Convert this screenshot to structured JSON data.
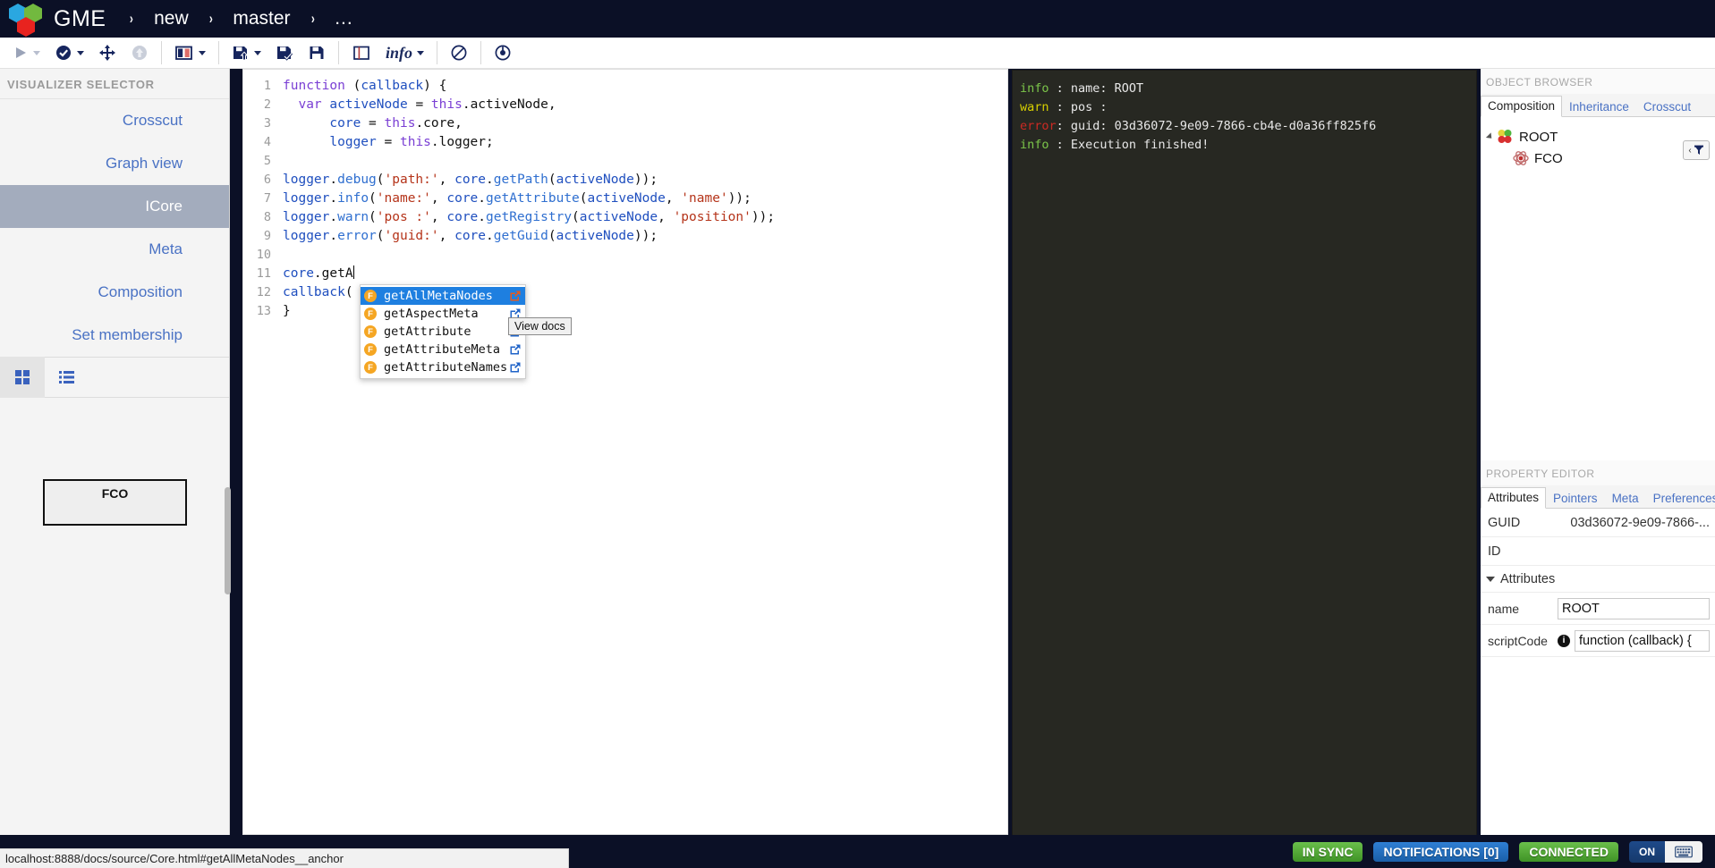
{
  "header": {
    "brand": "GME",
    "separator": "›",
    "breadcrumbs": [
      {
        "label": "new"
      },
      {
        "label": "master"
      },
      {
        "label": "..."
      }
    ]
  },
  "toolbar": {
    "items": [
      {
        "name": "execute-button",
        "icon": "play-icon",
        "caret": true
      },
      {
        "name": "check-button",
        "icon": "check-circle-icon",
        "caret": true
      },
      {
        "name": "move-button",
        "icon": "move-arrows-icon",
        "caret": false
      },
      {
        "name": "upload-button",
        "icon": "up-arrow-circle-icon",
        "caret": false
      },
      {
        "name": "split-view-button",
        "icon": "columns-icon",
        "caret": true
      },
      {
        "name": "save-as-button",
        "icon": "save-up-icon",
        "caret": true
      },
      {
        "name": "save-check-button",
        "icon": "save-check-icon",
        "caret": false
      },
      {
        "name": "save-button",
        "icon": "floppy-disk-icon",
        "caret": false
      },
      {
        "name": "layout-button",
        "icon": "panel-icon",
        "caret": false
      },
      {
        "name": "info-dropdown",
        "icon": "info-label",
        "label": "info",
        "caret": true
      },
      {
        "name": "disable-button",
        "icon": "ban-icon",
        "caret": false
      },
      {
        "name": "history-button",
        "icon": "clock-circle-icon",
        "caret": false
      }
    ]
  },
  "sidebar": {
    "title": "VISUALIZER SELECTOR",
    "items": [
      {
        "label": "Crosscut",
        "active": false
      },
      {
        "label": "Graph view",
        "active": false
      },
      {
        "label": "ICore",
        "active": true
      },
      {
        "label": "Meta",
        "active": false
      },
      {
        "label": "Composition",
        "active": false
      },
      {
        "label": "Set membership",
        "active": false
      }
    ],
    "view_tabs": [
      {
        "name": "grid-view-tab",
        "icon": "grid-icon",
        "selected": true
      },
      {
        "name": "list-view-tab",
        "icon": "list-icon",
        "selected": false
      }
    ],
    "canvas_node": {
      "label": "FCO"
    }
  },
  "editor": {
    "line_numbers": [
      "1",
      "2",
      "3",
      "4",
      "5",
      "6",
      "7",
      "8",
      "9",
      "10",
      "11",
      "12",
      "13"
    ],
    "lines": [
      [
        {
          "t": "kw",
          "s": "function"
        },
        {
          "t": "pl",
          "s": " ("
        },
        {
          "t": "var",
          "s": "callback"
        },
        {
          "t": "pl",
          "s": ") {"
        }
      ],
      [
        {
          "t": "pl",
          "s": "  "
        },
        {
          "t": "kw",
          "s": "var"
        },
        {
          "t": "pl",
          "s": " "
        },
        {
          "t": "var",
          "s": "activeNode"
        },
        {
          "t": "pl",
          "s": " = "
        },
        {
          "t": "kw",
          "s": "this"
        },
        {
          "t": "pl",
          "s": ".activeNode,"
        }
      ],
      [
        {
          "t": "pl",
          "s": "      "
        },
        {
          "t": "var",
          "s": "core"
        },
        {
          "t": "pl",
          "s": " = "
        },
        {
          "t": "kw",
          "s": "this"
        },
        {
          "t": "pl",
          "s": ".core,"
        }
      ],
      [
        {
          "t": "pl",
          "s": "      "
        },
        {
          "t": "var",
          "s": "logger"
        },
        {
          "t": "pl",
          "s": " = "
        },
        {
          "t": "kw",
          "s": "this"
        },
        {
          "t": "pl",
          "s": ".logger;"
        }
      ],
      [],
      [
        {
          "t": "var",
          "s": "logger"
        },
        {
          "t": "pl",
          "s": "."
        },
        {
          "t": "fn",
          "s": "debug"
        },
        {
          "t": "pl",
          "s": "("
        },
        {
          "t": "str",
          "s": "'path:'"
        },
        {
          "t": "pl",
          "s": ", "
        },
        {
          "t": "var",
          "s": "core"
        },
        {
          "t": "pl",
          "s": "."
        },
        {
          "t": "fn",
          "s": "getPath"
        },
        {
          "t": "pl",
          "s": "("
        },
        {
          "t": "var",
          "s": "activeNode"
        },
        {
          "t": "pl",
          "s": "));"
        }
      ],
      [
        {
          "t": "var",
          "s": "logger"
        },
        {
          "t": "pl",
          "s": "."
        },
        {
          "t": "fn",
          "s": "info"
        },
        {
          "t": "pl",
          "s": "("
        },
        {
          "t": "str",
          "s": "'name:'"
        },
        {
          "t": "pl",
          "s": ", "
        },
        {
          "t": "var",
          "s": "core"
        },
        {
          "t": "pl",
          "s": "."
        },
        {
          "t": "fn",
          "s": "getAttribute"
        },
        {
          "t": "pl",
          "s": "("
        },
        {
          "t": "var",
          "s": "activeNode"
        },
        {
          "t": "pl",
          "s": ", "
        },
        {
          "t": "str",
          "s": "'name'"
        },
        {
          "t": "pl",
          "s": "));"
        }
      ],
      [
        {
          "t": "var",
          "s": "logger"
        },
        {
          "t": "pl",
          "s": "."
        },
        {
          "t": "fn",
          "s": "warn"
        },
        {
          "t": "pl",
          "s": "("
        },
        {
          "t": "str",
          "s": "'pos :'"
        },
        {
          "t": "pl",
          "s": ", "
        },
        {
          "t": "var",
          "s": "core"
        },
        {
          "t": "pl",
          "s": "."
        },
        {
          "t": "fn",
          "s": "getRegistry"
        },
        {
          "t": "pl",
          "s": "("
        },
        {
          "t": "var",
          "s": "activeNode"
        },
        {
          "t": "pl",
          "s": ", "
        },
        {
          "t": "str",
          "s": "'position'"
        },
        {
          "t": "pl",
          "s": "));"
        }
      ],
      [
        {
          "t": "var",
          "s": "logger"
        },
        {
          "t": "pl",
          "s": "."
        },
        {
          "t": "fn",
          "s": "error"
        },
        {
          "t": "pl",
          "s": "("
        },
        {
          "t": "str",
          "s": "'guid:'"
        },
        {
          "t": "pl",
          "s": ", "
        },
        {
          "t": "var",
          "s": "core"
        },
        {
          "t": "pl",
          "s": "."
        },
        {
          "t": "fn",
          "s": "getGuid"
        },
        {
          "t": "pl",
          "s": "("
        },
        {
          "t": "var",
          "s": "activeNode"
        },
        {
          "t": "pl",
          "s": "));"
        }
      ],
      [],
      [
        {
          "t": "var",
          "s": "core"
        },
        {
          "t": "pl",
          "s": ".getA"
        }
      ],
      [
        {
          "t": "var",
          "s": "callback"
        },
        {
          "t": "pl",
          "s": "("
        }
      ],
      [
        {
          "t": "pl",
          "s": "}"
        }
      ]
    ]
  },
  "autocomplete": {
    "items": [
      {
        "label": "getAllMetaNodes",
        "kind": "F",
        "selected": true,
        "has_link": true
      },
      {
        "label": "getAspectMeta",
        "kind": "F",
        "selected": false,
        "has_link": true
      },
      {
        "label": "getAttribute",
        "kind": "F",
        "selected": false,
        "has_link": true
      },
      {
        "label": "getAttributeMeta",
        "kind": "F",
        "selected": false,
        "has_link": true
      },
      {
        "label": "getAttributeNames",
        "kind": "F",
        "selected": false,
        "has_link": true
      }
    ],
    "tooltip": "View docs"
  },
  "console": {
    "rows": [
      {
        "level": "info",
        "level_text": "info ",
        "sep": ": ",
        "message": "name: ROOT"
      },
      {
        "level": "warn",
        "level_text": "warn ",
        "sep": ": ",
        "message": "pos :"
      },
      {
        "level": "error",
        "level_text": "error",
        "sep": ": ",
        "message": "guid: 03d36072-9e09-7866-cb4e-d0a36ff825f6"
      },
      {
        "level": "info",
        "level_text": "info ",
        "sep": ": ",
        "message": "Execution finished!"
      }
    ]
  },
  "object_browser": {
    "title": "OBJECT BROWSER",
    "tabs": [
      {
        "label": "Composition",
        "active": true
      },
      {
        "label": "Inheritance",
        "active": false
      },
      {
        "label": "Crosscut",
        "active": false
      }
    ],
    "tree": [
      {
        "label": "ROOT",
        "depth": 0,
        "icon": "root-balls-icon",
        "expandable": true
      },
      {
        "label": "FCO",
        "depth": 1,
        "icon": "fco-atom-icon",
        "expandable": false
      }
    ]
  },
  "property_editor": {
    "title": "PROPERTY EDITOR",
    "tabs": [
      {
        "label": "Attributes",
        "active": true
      },
      {
        "label": "Pointers",
        "active": false
      },
      {
        "label": "Meta",
        "active": false
      },
      {
        "label": "Preferences",
        "active": false
      }
    ],
    "readonly_rows": [
      {
        "key": "GUID",
        "value": "03d36072-9e09-7866-..."
      },
      {
        "key": "ID",
        "value": ""
      }
    ],
    "group_label": "Attributes",
    "fields": [
      {
        "key": "name",
        "value": "ROOT",
        "has_info": false
      },
      {
        "key": "scriptCode",
        "value": "function (callback) {",
        "has_info": true
      }
    ]
  },
  "statusbar": {
    "sync": "IN SYNC",
    "notifications": "NOTIFICATIONS [0]",
    "connection": "CONNECTED",
    "toggle_label": "ON",
    "toggle_icon": "keyboard-icon"
  },
  "urlbar": {
    "url": "localhost:8888/docs/source/Core.html#getAllMetaNodes__anchor"
  }
}
